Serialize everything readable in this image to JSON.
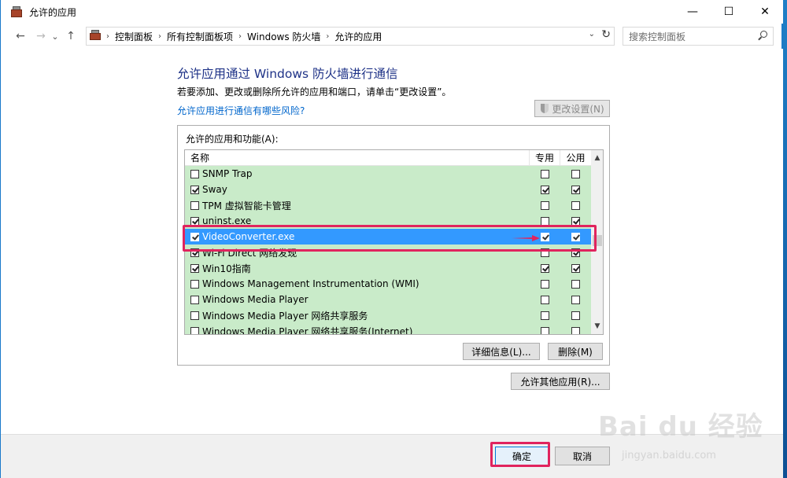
{
  "window": {
    "title": "允许的应用",
    "minimize": "—",
    "maximize": "☐",
    "close": "✕"
  },
  "nav": {
    "back": "←",
    "forward": "→",
    "recent": "⌄",
    "up": "↑",
    "breadcrumbs": [
      "控制面板",
      "所有控制面板项",
      "Windows 防火墙",
      "允许的应用"
    ],
    "separator": "›",
    "dropdown": "⌄",
    "refresh": "↻",
    "search_placeholder": "搜索控制面板"
  },
  "main": {
    "heading": "允许应用通过 Windows 防火墙进行通信",
    "subtext": "若要添加、更改或删除所允许的应用和端口，请单击“更改设置”。",
    "risk_link": "允许应用进行通信有哪些风险?",
    "change_settings": "更改设置(N)",
    "group_label": "允许的应用和功能(A):",
    "columns": {
      "name": "名称",
      "private": "专用",
      "public": "公用"
    },
    "rows": [
      {
        "name": "SNMP Trap",
        "enabled": false,
        "private": false,
        "public": false
      },
      {
        "name": "Sway",
        "enabled": true,
        "private": true,
        "public": true
      },
      {
        "name": "TPM 虚拟智能卡管理",
        "enabled": false,
        "private": false,
        "public": false
      },
      {
        "name": "uninst.exe",
        "enabled": true,
        "private": false,
        "public": true
      },
      {
        "name": "VideoConverter.exe",
        "enabled": true,
        "private": true,
        "public": true,
        "selected": true
      },
      {
        "name": "Wi-Fi Direct 网络发现",
        "enabled": true,
        "private": false,
        "public": true
      },
      {
        "name": "Win10指南",
        "enabled": true,
        "private": true,
        "public": true
      },
      {
        "name": "Windows Management Instrumentation (WMI)",
        "enabled": false,
        "private": false,
        "public": false
      },
      {
        "name": "Windows Media Player",
        "enabled": false,
        "private": false,
        "public": false
      },
      {
        "name": "Windows Media Player 网络共享服务",
        "enabled": false,
        "private": false,
        "public": false
      },
      {
        "name": "Windows Media Player 网络共享服务(Internet)",
        "enabled": false,
        "private": false,
        "public": false
      }
    ],
    "details_button": "详细信息(L)...",
    "remove_button": "删除(M)",
    "allow_other_button": "允许其他应用(R)..."
  },
  "footer": {
    "ok": "确定",
    "cancel": "取消"
  },
  "watermark": {
    "logo": "Bai du 经验",
    "url": "jingyan.baidu.com"
  },
  "colors": {
    "accent": "#e0245e",
    "selection": "#3399ff",
    "allowed_row_bg": "#c9ebc9",
    "heading": "#1e3287",
    "link": "#0066cc"
  }
}
